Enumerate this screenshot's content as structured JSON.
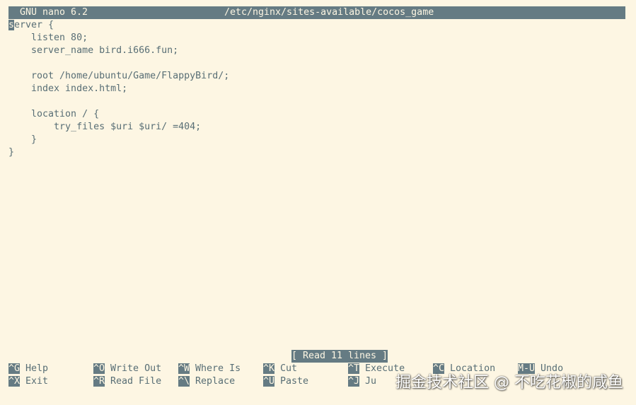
{
  "titlebar": {
    "app": "GNU nano 6.2",
    "file": "/etc/nginx/sites-available/cocos_game"
  },
  "editor": {
    "cursor_char": "s",
    "first_line_rest": "erver {",
    "lines": [
      "    listen 80;",
      "    server_name bird.i666.fun;",
      "",
      "    root /home/ubuntu/Game/FlappyBird/;",
      "    index index.html;",
      "",
      "    location / {",
      "        try_files $uri $uri/ =404;",
      "    }",
      "}"
    ]
  },
  "status": {
    "message": "[ Read 11 lines ]"
  },
  "shortcuts": {
    "row1": [
      {
        "key": "^G",
        "label": "Help"
      },
      {
        "key": "^O",
        "label": "Write Out"
      },
      {
        "key": "^W",
        "label": "Where Is"
      },
      {
        "key": "^K",
        "label": "Cut"
      },
      {
        "key": "^T",
        "label": "Execute"
      },
      {
        "key": "^C",
        "label": "Location"
      },
      {
        "key": "M-U",
        "label": "Undo"
      }
    ],
    "row2": [
      {
        "key": "^X",
        "label": "Exit"
      },
      {
        "key": "^R",
        "label": "Read File"
      },
      {
        "key": "^\\",
        "label": "Replace"
      },
      {
        "key": "^U",
        "label": "Paste"
      },
      {
        "key": "^J",
        "label": "Ju"
      },
      {
        "key": "",
        "label": ""
      },
      {
        "key": "",
        "label": ""
      }
    ]
  },
  "watermark": "掘金技术社区 @ 不吃花椒的咸鱼",
  "colors": {
    "background": "#fdf6e3",
    "bar": "#657b83",
    "text": "#586e75"
  }
}
